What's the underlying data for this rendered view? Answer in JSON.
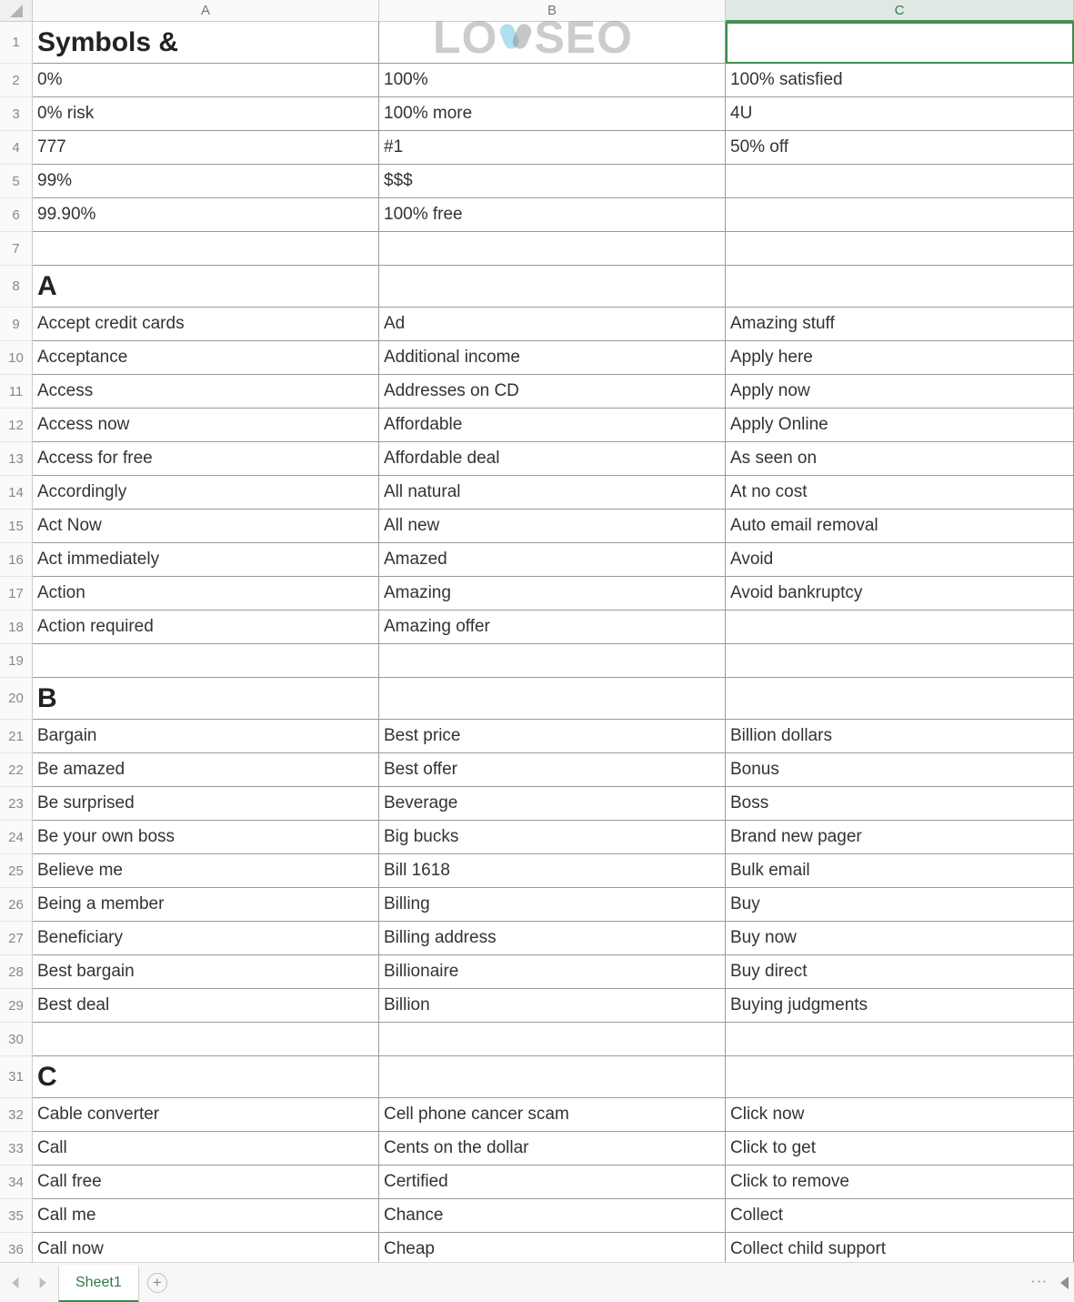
{
  "watermark": {
    "pre": "LO",
    "post": "SEO"
  },
  "columns": [
    "A",
    "B",
    "C"
  ],
  "selected_col_index": 2,
  "selected_cell": {
    "row": 1,
    "col": 2
  },
  "sheet_tab": {
    "name": "Sheet1"
  },
  "rows": [
    {
      "n": 1,
      "h": "tall",
      "bold": true,
      "A": "Symbols &",
      "B": "",
      "C": ""
    },
    {
      "n": 2,
      "A": "0%",
      "B": "100%",
      "C": "100% satisfied"
    },
    {
      "n": 3,
      "A": "0% risk",
      "B": "100% more",
      "C": "4U"
    },
    {
      "n": 4,
      "A": "777",
      "B": "#1",
      "C": "50% off"
    },
    {
      "n": 5,
      "A": "99%",
      "B": "$$$",
      "C": ""
    },
    {
      "n": 6,
      "A": "99.90%",
      "B": "100% free",
      "C": ""
    },
    {
      "n": 7,
      "A": "",
      "B": "",
      "C": ""
    },
    {
      "n": 8,
      "h": "tall",
      "bold": true,
      "A": "A",
      "B": "",
      "C": ""
    },
    {
      "n": 9,
      "A": "Accept credit cards",
      "B": "Ad",
      "C": "Amazing stuff"
    },
    {
      "n": 10,
      "A": "Acceptance",
      "B": "Additional income",
      "C": "Apply here"
    },
    {
      "n": 11,
      "A": "Access",
      "B": "Addresses on CD",
      "C": "Apply now"
    },
    {
      "n": 12,
      "A": "Access now",
      "B": "Affordable",
      "C": "Apply Online"
    },
    {
      "n": 13,
      "A": "Access for free",
      "B": "Affordable deal",
      "C": "As seen on"
    },
    {
      "n": 14,
      "A": "Accordingly",
      "B": "All natural",
      "C": "At no cost"
    },
    {
      "n": 15,
      "A": "Act Now",
      "B": "All new",
      "C": "Auto email removal"
    },
    {
      "n": 16,
      "A": "Act immediately",
      "B": "Amazed",
      "C": "Avoid"
    },
    {
      "n": 17,
      "A": "Action",
      "B": "Amazing",
      "C": "Avoid bankruptcy"
    },
    {
      "n": 18,
      "A": "Action required",
      "B": "Amazing offer",
      "C": ""
    },
    {
      "n": 19,
      "A": "",
      "B": "",
      "C": ""
    },
    {
      "n": 20,
      "h": "tall",
      "bold": true,
      "A": "B",
      "B": "",
      "C": ""
    },
    {
      "n": 21,
      "A": "Bargain",
      "B": "Best price",
      "C": "Billion dollars"
    },
    {
      "n": 22,
      "A": "Be amazed",
      "B": "Best offer",
      "C": "Bonus"
    },
    {
      "n": 23,
      "A": "Be surprised",
      "B": "Beverage",
      "C": "Boss"
    },
    {
      "n": 24,
      "A": "Be your own boss",
      "B": "Big bucks",
      "C": "Brand new pager"
    },
    {
      "n": 25,
      "A": "Believe me",
      "B": "Bill 1618",
      "C": "Bulk email"
    },
    {
      "n": 26,
      "A": "Being a member",
      "B": "Billing",
      "C": "Buy"
    },
    {
      "n": 27,
      "A": "Beneficiary",
      "B": "Billing address",
      "C": "Buy now"
    },
    {
      "n": 28,
      "A": "Best bargain",
      "B": "Billionaire",
      "C": "Buy direct"
    },
    {
      "n": 29,
      "A": "Best deal",
      "B": "Billion",
      "C": "Buying judgments"
    },
    {
      "n": 30,
      "A": "",
      "B": "",
      "C": ""
    },
    {
      "n": 31,
      "h": "tall",
      "bold": true,
      "A": "C",
      "B": "",
      "C": ""
    },
    {
      "n": 32,
      "A": "Cable converter",
      "B": "Cell phone cancer scam",
      "C": "Click now"
    },
    {
      "n": 33,
      "A": "Call",
      "B": "Cents on the dollar",
      "C": "Click to get"
    },
    {
      "n": 34,
      "A": "Call free",
      "B": "Certified",
      "C": "Click to remove"
    },
    {
      "n": 35,
      "A": "Call me",
      "B": "Chance",
      "C": "Collect"
    },
    {
      "n": 36,
      "A": "Call now",
      "B": "Cheap",
      "C": "Collect child support"
    }
  ]
}
